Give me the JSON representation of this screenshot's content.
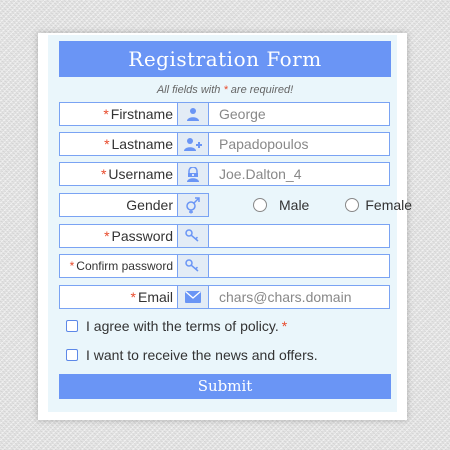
{
  "form": {
    "title": "Registration Form",
    "note_prefix": "All fields with",
    "note_star": "*",
    "note_suffix": "are required!",
    "required_marker": "*",
    "accent_color": "#6a95f5",
    "required_color": "#e84a2b"
  },
  "fields": {
    "firstname": {
      "label": "Firstname",
      "icon": "user-icon",
      "placeholder": "George"
    },
    "lastname": {
      "label": "Lastname",
      "icon": "add-user-icon",
      "placeholder": "Papadopoulos"
    },
    "username": {
      "label": "Username",
      "icon": "user-lock-icon",
      "placeholder": "Joe.Dalton_4"
    },
    "gender": {
      "label": "Gender",
      "icon": "gender-icon",
      "options": [
        "Male",
        "Female"
      ]
    },
    "password": {
      "label": "Password",
      "icon": "key-icon",
      "placeholder": ""
    },
    "confirm_password": {
      "label": "Confirm password",
      "icon": "key-icon",
      "placeholder": ""
    },
    "email": {
      "label": "Email",
      "icon": "envelope-icon",
      "placeholder": "chars@chars.domain"
    }
  },
  "checkboxes": {
    "terms": "I agree with the terms of policy.",
    "news": "I want to receive the news and offers."
  },
  "submit_label": "Submit"
}
